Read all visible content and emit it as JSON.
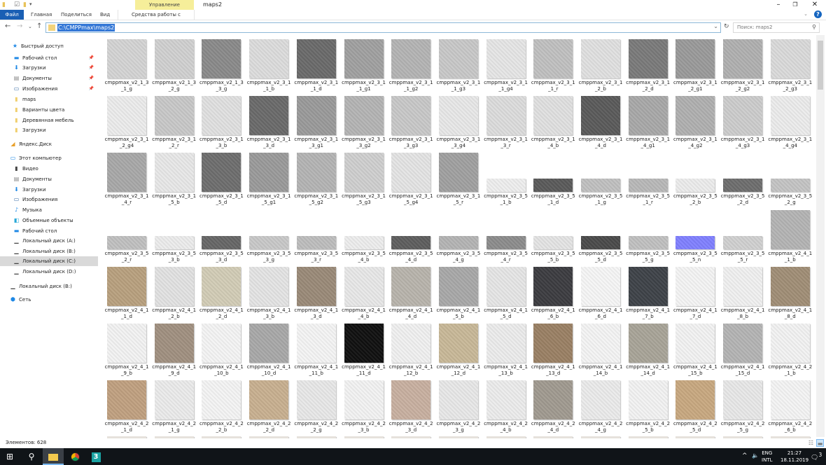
{
  "window": {
    "title": "maps2",
    "context_tab_header": "Управление"
  },
  "ribbon": {
    "tabs": [
      "Файл",
      "Главная",
      "Поделиться",
      "Вид"
    ],
    "context_tab": "Средства работы с рисунками"
  },
  "nav": {
    "address": "C:\\CMPPmax\\maps2",
    "search_placeholder": "Поиск: maps2"
  },
  "sidebar": {
    "items": [
      {
        "label": "Быстрый доступ",
        "icon": "star-icon",
        "level": 0
      },
      {
        "label": "Рабочий стол",
        "icon": "desktop-icon",
        "level": 1,
        "pinned": true
      },
      {
        "label": "Загрузки",
        "icon": "download-icon",
        "level": 1,
        "pinned": true
      },
      {
        "label": "Документы",
        "icon": "document-icon",
        "level": 1,
        "pinned": true
      },
      {
        "label": "Изображения",
        "icon": "pictures-icon",
        "level": 1,
        "pinned": true
      },
      {
        "label": "maps",
        "icon": "folder-icon",
        "level": 1
      },
      {
        "label": "Варианты цвета",
        "icon": "folder-icon",
        "level": 1
      },
      {
        "label": "Деревянная мебель",
        "icon": "folder-icon",
        "level": 1
      },
      {
        "label": "Загрузки",
        "icon": "folder-icon",
        "level": 1
      },
      {
        "label": "Яндекс.Диск",
        "icon": "yandex-disk-icon",
        "level": 0
      },
      {
        "label": "Этот компьютер",
        "icon": "computer-icon",
        "level": 0
      },
      {
        "label": "Видео",
        "icon": "video-icon",
        "level": 1
      },
      {
        "label": "Документы",
        "icon": "document-icon",
        "level": 1
      },
      {
        "label": "Загрузки",
        "icon": "download-icon",
        "level": 1
      },
      {
        "label": "Изображения",
        "icon": "pictures-icon",
        "level": 1
      },
      {
        "label": "Музыка",
        "icon": "music-icon",
        "level": 1
      },
      {
        "label": "Объемные объекты",
        "icon": "3d-objects-icon",
        "level": 1
      },
      {
        "label": "Рабочий стол",
        "icon": "desktop-icon",
        "level": 1
      },
      {
        "label": "Локальный диск (A:)",
        "icon": "drive-icon",
        "level": 1
      },
      {
        "label": "Локальный диск (B:)",
        "icon": "drive-icon",
        "level": 1
      },
      {
        "label": "Локальный диск (C:)",
        "icon": "drive-icon",
        "level": 1,
        "selected": true
      },
      {
        "label": "Локальный диск (D:)",
        "icon": "drive-icon",
        "level": 1
      },
      {
        "label": "Локальный диск (B:)",
        "icon": "drive-icon",
        "level": 0
      },
      {
        "label": "Сеть",
        "icon": "network-icon",
        "level": 0
      }
    ]
  },
  "files": [
    {
      "name": "cmppmax_v2_1_3_1_g",
      "tone": "#d4d4d4"
    },
    {
      "name": "cmppmax_v2_1_3_2_g",
      "tone": "#d0d0d0"
    },
    {
      "name": "cmppmax_v2_1_3_3_g",
      "tone": "#8a8a8a"
    },
    {
      "name": "cmppmax_v2_3_1_1_b",
      "tone": "#dcdcdc"
    },
    {
      "name": "cmppmax_v2_3_1_1_d",
      "tone": "#6a6a6a"
    },
    {
      "name": "cmppmax_v2_3_1_1_g1",
      "tone": "#a0a0a0"
    },
    {
      "name": "cmppmax_v2_3_1_1_g2",
      "tone": "#b4b4b4"
    },
    {
      "name": "cmppmax_v2_3_1_1_g3",
      "tone": "#c8c8c8"
    },
    {
      "name": "cmppmax_v2_3_1_1_g4",
      "tone": "#e6e6e6"
    },
    {
      "name": "cmppmax_v2_3_1_1_r",
      "tone": "#c0c0c0"
    },
    {
      "name": "cmppmax_v2_3_1_2_b",
      "tone": "#e0e0e0"
    },
    {
      "name": "cmppmax_v2_3_1_2_d",
      "tone": "#7a7a7a"
    },
    {
      "name": "cmppmax_v2_3_1_2_g1",
      "tone": "#9a9a9a"
    },
    {
      "name": "cmppmax_v2_3_1_2_g2",
      "tone": "#b0b0b0"
    },
    {
      "name": "cmppmax_v2_3_1_2_g3",
      "tone": "#dadada"
    },
    {
      "name": "cmppmax_v2_3_1_2_g4",
      "tone": "#ececec"
    },
    {
      "name": "cmppmax_v2_3_1_2_r",
      "tone": "#c8c8c8"
    },
    {
      "name": "cmppmax_v2_3_1_3_b",
      "tone": "#e0e0e0"
    },
    {
      "name": "cmppmax_v2_3_1_3_d",
      "tone": "#6a6a6a"
    },
    {
      "name": "cmppmax_v2_3_1_3_g1",
      "tone": "#9a9a9a"
    },
    {
      "name": "cmppmax_v2_3_1_3_g2",
      "tone": "#b4b4b4"
    },
    {
      "name": "cmppmax_v2_3_1_3_g3",
      "tone": "#c8c8c8"
    },
    {
      "name": "cmppmax_v2_3_1_3_g4",
      "tone": "#e8e8e8"
    },
    {
      "name": "cmppmax_v2_3_1_3_r",
      "tone": "#dcdcdc"
    },
    {
      "name": "cmppmax_v2_3_1_4_b",
      "tone": "#e0e0e0"
    },
    {
      "name": "cmppmax_v2_3_1_4_d",
      "tone": "#5a5a5a"
    },
    {
      "name": "cmppmax_v2_3_1_4_g1",
      "tone": "#a8a8a8"
    },
    {
      "name": "cmppmax_v2_3_1_4_g2",
      "tone": "#b0b0b0"
    },
    {
      "name": "cmppmax_v2_3_1_4_g3",
      "tone": "#cccccc"
    },
    {
      "name": "cmppmax_v2_3_1_4_g4",
      "tone": "#ececec"
    },
    {
      "name": "cmppmax_v2_3_1_4_r",
      "tone": "#a8a8a8"
    },
    {
      "name": "cmppmax_v2_3_1_5_b",
      "tone": "#e8e8e8"
    },
    {
      "name": "cmppmax_v2_3_1_5_d",
      "tone": "#6e6e6e"
    },
    {
      "name": "cmppmax_v2_3_1_5_g1",
      "tone": "#9a9a9a"
    },
    {
      "name": "cmppmax_v2_3_1_5_g2",
      "tone": "#b4b4b4"
    },
    {
      "name": "cmppmax_v2_3_1_5_g3",
      "tone": "#cfcfcf"
    },
    {
      "name": "cmppmax_v2_3_1_5_g4",
      "tone": "#e4e4e4"
    },
    {
      "name": "cmppmax_v2_3_1_5_r",
      "tone": "#a0a0a0"
    },
    {
      "name": "cmppmax_v2_3_5_1_b",
      "tone": "#eeeeee",
      "wide": true
    },
    {
      "name": "cmppmax_v2_3_5_1_d",
      "tone": "#5a5a5a",
      "wide": true
    },
    {
      "name": "cmppmax_v2_3_5_1_g",
      "tone": "#c0c0c0",
      "wide": true
    },
    {
      "name": "cmppmax_v2_3_5_1_r",
      "tone": "#b8b8b8",
      "wide": true
    },
    {
      "name": "cmppmax_v2_3_5_2_b",
      "tone": "#ececec",
      "wide": true
    },
    {
      "name": "cmppmax_v2_3_5_2_d",
      "tone": "#6e6e6e",
      "wide": true
    },
    {
      "name": "cmppmax_v2_3_5_2_g",
      "tone": "#c4c4c4",
      "wide": true
    },
    {
      "name": "cmppmax_v2_3_5_2_r",
      "tone": "#c0c0c0",
      "wide": true
    },
    {
      "name": "cmppmax_v2_3_5_3_b",
      "tone": "#ececec",
      "wide": true
    },
    {
      "name": "cmppmax_v2_3_5_3_d",
      "tone": "#666666",
      "wide": true
    },
    {
      "name": "cmppmax_v2_3_5_3_g",
      "tone": "#c8c8c8",
      "wide": true
    },
    {
      "name": "cmppmax_v2_3_5_3_r",
      "tone": "#bdbdbd",
      "wide": true
    },
    {
      "name": "cmppmax_v2_3_5_4_b",
      "tone": "#ededed",
      "wide": true
    },
    {
      "name": "cmppmax_v2_3_5_4_d",
      "tone": "#5e5e5e",
      "wide": true
    },
    {
      "name": "cmppmax_v2_3_5_4_g",
      "tone": "#b4b4b4",
      "wide": true
    },
    {
      "name": "cmppmax_v2_3_5_4_r",
      "tone": "#8c8c8c",
      "wide": true
    },
    {
      "name": "cmppmax_v2_3_5_5_b",
      "tone": "#e4e4e4",
      "wide": true
    },
    {
      "name": "cmppmax_v2_3_5_5_d",
      "tone": "#4a4a4a",
      "wide": true
    },
    {
      "name": "cmppmax_v2_3_5_5_g",
      "tone": "#c0c0c0",
      "wide": true
    },
    {
      "name": "cmppmax_v2_3_5_5_n",
      "tone": "#8080ff",
      "wide": true
    },
    {
      "name": "cmppmax_v2_3_5_5_r",
      "tone": "#d0d0d0",
      "wide": true
    },
    {
      "name": "cmppmax_v2_4_1_1_b",
      "tone": "#b4b4b4"
    },
    {
      "name": "cmppmax_v2_4_1_1_d",
      "tone": "#b8a07e"
    },
    {
      "name": "cmppmax_v2_4_1_2_b",
      "tone": "#e2e2e2"
    },
    {
      "name": "cmppmax_v2_4_1_2_d",
      "tone": "#d2ccb6"
    },
    {
      "name": "cmppmax_v2_4_1_3_b",
      "tone": "#e4e4e4"
    },
    {
      "name": "cmppmax_v2_4_1_3_d",
      "tone": "#9a8a78"
    },
    {
      "name": "cmppmax_v2_4_1_4_b",
      "tone": "#e8e8e8"
    },
    {
      "name": "cmppmax_v2_4_1_4_d",
      "tone": "#b8b4ac"
    },
    {
      "name": "cmppmax_v2_4_1_5_b",
      "tone": "#a8a8a8"
    },
    {
      "name": "cmppmax_v2_4_1_5_d",
      "tone": "#e6e6e6"
    },
    {
      "name": "cmppmax_v2_4_1_6_b",
      "tone": "#3c3c40"
    },
    {
      "name": "cmppmax_v2_4_1_6_d",
      "tone": "#f6f6f6"
    },
    {
      "name": "cmppmax_v2_4_1_7_b",
      "tone": "#3e4248"
    },
    {
      "name": "cmppmax_v2_4_1_7_d",
      "tone": "#f4f4f4"
    },
    {
      "name": "cmppmax_v2_4_1_8_b",
      "tone": "#f0f0f0"
    },
    {
      "name": "cmppmax_v2_4_1_8_d",
      "tone": "#a08e76"
    },
    {
      "name": "cmppmax_v2_4_1_9_b",
      "tone": "#f2f2f2"
    },
    {
      "name": "cmppmax_v2_4_1_9_d",
      "tone": "#a09080"
    },
    {
      "name": "cmppmax_v2_4_1_10_b",
      "tone": "#f4f4f4"
    },
    {
      "name": "cmppmax_v2_4_1_10_d",
      "tone": "#a8a8a8"
    },
    {
      "name": "cmppmax_v2_4_1_11_b",
      "tone": "#f4f4f4"
    },
    {
      "name": "cmppmax_v2_4_1_11_d",
      "tone": "#101010"
    },
    {
      "name": "cmppmax_v2_4_1_12_b",
      "tone": "#f0f0f0"
    },
    {
      "name": "cmppmax_v2_4_1_12_d",
      "tone": "#c8b898"
    },
    {
      "name": "cmppmax_v2_4_1_13_b",
      "tone": "#ececec"
    },
    {
      "name": "cmppmax_v2_4_1_13_d",
      "tone": "#9a8064"
    },
    {
      "name": "cmppmax_v2_4_1_14_b",
      "tone": "#f4f4f4"
    },
    {
      "name": "cmppmax_v2_4_1_14_d",
      "tone": "#a8a498"
    },
    {
      "name": "cmppmax_v2_4_1_15_b",
      "tone": "#f2f2f2"
    },
    {
      "name": "cmppmax_v2_4_1_15_d",
      "tone": "#b4b4b4"
    },
    {
      "name": "cmppmax_v2_4_2_1_b",
      "tone": "#f2f2f2"
    },
    {
      "name": "cmppmax_v2_4_2_1_d",
      "tone": "#c0a080"
    },
    {
      "name": "cmppmax_v2_4_2_1_g",
      "tone": "#ebebeb"
    },
    {
      "name": "cmppmax_v2_4_2_2_b",
      "tone": "#f4f4f4"
    },
    {
      "name": "cmppmax_v2_4_2_2_d",
      "tone": "#c8b090"
    },
    {
      "name": "cmppmax_v2_4_2_2_g",
      "tone": "#e8e8e8"
    },
    {
      "name": "cmppmax_v2_4_2_3_b",
      "tone": "#f2f2f2"
    },
    {
      "name": "cmppmax_v2_4_2_3_d",
      "tone": "#c8b0a0"
    },
    {
      "name": "cmppmax_v2_4_2_3_g",
      "tone": "#e8e8e8"
    },
    {
      "name": "cmppmax_v2_4_2_4_b",
      "tone": "#ececec"
    },
    {
      "name": "cmppmax_v2_4_2_4_d",
      "tone": "#a09a90"
    },
    {
      "name": "cmppmax_v2_4_2_4_g",
      "tone": "#ebebeb"
    },
    {
      "name": "cmppmax_v2_4_2_5_b",
      "tone": "#f2f2f2"
    },
    {
      "name": "cmppmax_v2_4_2_5_d",
      "tone": "#c8a880"
    },
    {
      "name": "cmppmax_v2_4_2_5_g",
      "tone": "#e8e8e8"
    },
    {
      "name": "cmppmax_v2_4_2_6_b",
      "tone": "#f4f4f4"
    }
  ],
  "status": {
    "count": "Элементов: 628"
  },
  "taskbar": {
    "lang": "ENG",
    "layout": "INTL",
    "time": "21:27",
    "date": "18.11.2019",
    "notifications": "3",
    "app_3dsmax": "3"
  },
  "colors": {
    "accent": "#1a5fb4",
    "context_tab": "#f6ee9a",
    "selection": "#3377d6"
  }
}
